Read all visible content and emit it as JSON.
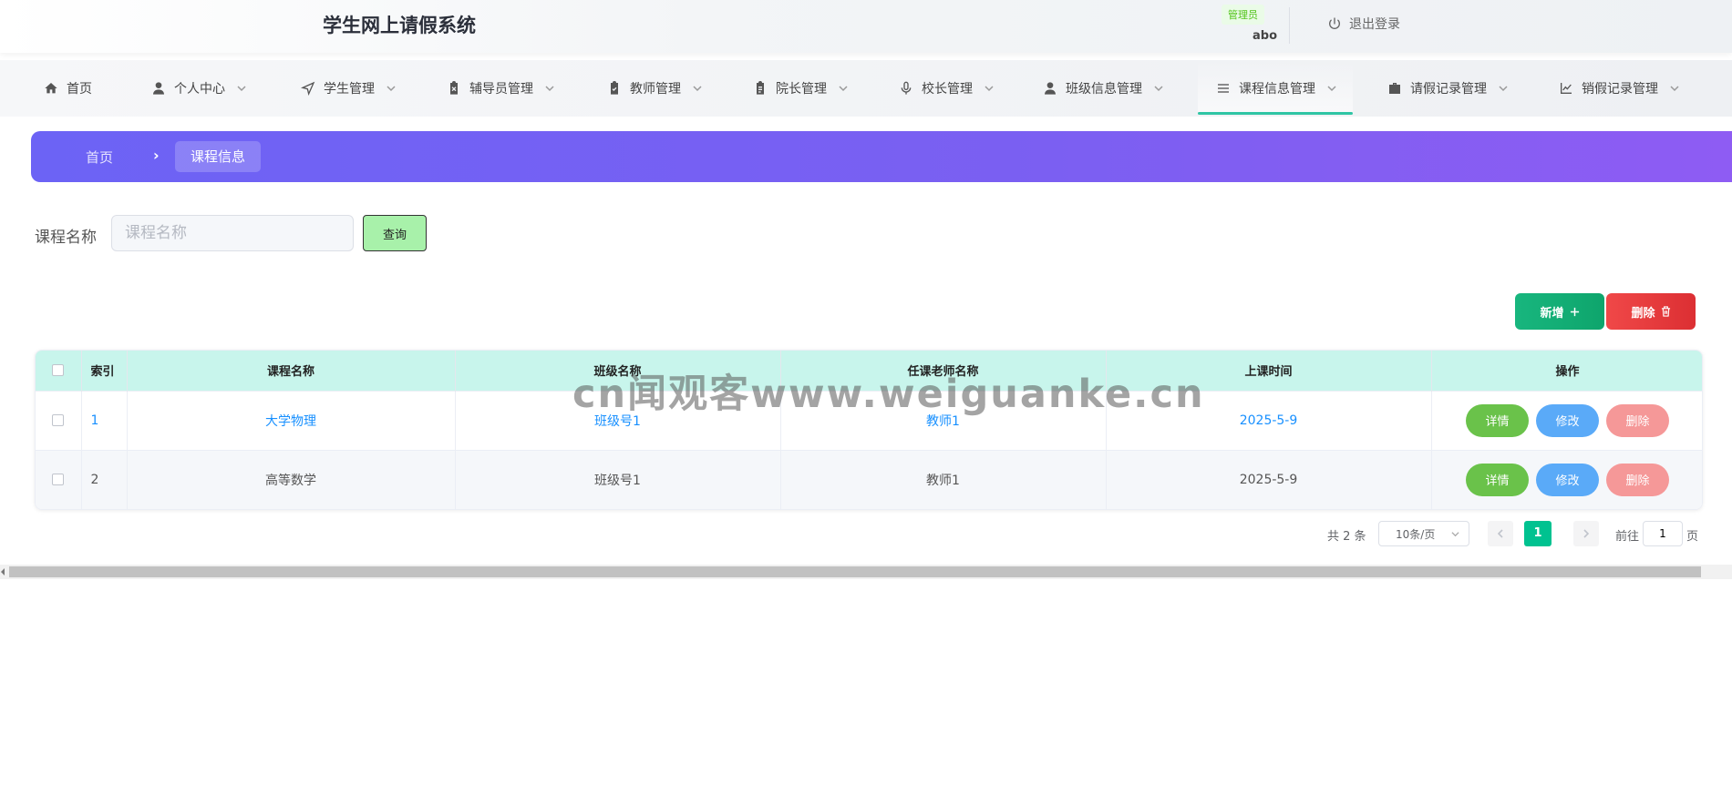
{
  "header": {
    "app_title": "学生网上请假系统",
    "role": "管理员",
    "username": "abo",
    "logout_label": "退出登录"
  },
  "nav": {
    "items": [
      {
        "label": "首页",
        "icon": "home-icon",
        "dropdown": false
      },
      {
        "label": "个人中心",
        "icon": "user-icon",
        "dropdown": true
      },
      {
        "label": "学生管理",
        "icon": "send-icon",
        "dropdown": true
      },
      {
        "label": "辅导员管理",
        "icon": "clipboard-x-icon",
        "dropdown": true
      },
      {
        "label": "教师管理",
        "icon": "clipboard-check-icon",
        "dropdown": true
      },
      {
        "label": "院长管理",
        "icon": "clipboard-icon",
        "dropdown": true
      },
      {
        "label": "校长管理",
        "icon": "microphone-icon",
        "dropdown": true
      },
      {
        "label": "班级信息管理",
        "icon": "user-icon",
        "dropdown": true
      },
      {
        "label": "课程信息管理",
        "icon": "list-icon",
        "dropdown": true,
        "active": true
      },
      {
        "label": "请假记录管理",
        "icon": "briefcase-icon",
        "dropdown": true
      },
      {
        "label": "销假记录管理",
        "icon": "chart-line-icon",
        "dropdown": true
      }
    ]
  },
  "breadcrumb": {
    "home": "首页",
    "separator": "›",
    "current": "课程信息"
  },
  "search": {
    "label": "课程名称",
    "placeholder": "课程名称",
    "value": "",
    "button_label": "查询"
  },
  "actions": {
    "add_label": "新增",
    "delete_label": "删除"
  },
  "table": {
    "columns": [
      "索引",
      "课程名称",
      "班级名称",
      "任课老师名称",
      "上课时间",
      "操作"
    ],
    "rows": [
      {
        "index": "1",
        "course": "大学物理",
        "class": "班级号1",
        "teacher": "教师1",
        "time": "2025-5-9"
      },
      {
        "index": "2",
        "course": "高等数学",
        "class": "班级号1",
        "teacher": "教师1",
        "time": "2025-5-9"
      }
    ],
    "row_actions": {
      "detail": "详情",
      "edit": "修改",
      "delete": "删除"
    }
  },
  "pagination": {
    "total": "共 2 条",
    "page_size": "10条/页",
    "current_page": "1",
    "goto_label": "前往",
    "goto_value": "1",
    "page_suffix": "页"
  },
  "watermark": "cn闻观客www.weiguanke.cn",
  "colors": {
    "accent": "#00c290",
    "breadcrumb_gradient_start": "#6c63f5",
    "breadcrumb_gradient_end": "#8e5cf3",
    "table_header": "#c8f5ec",
    "add_button": "#18b67e",
    "delete_button": "#e8383d",
    "detail_button": "#6ac24a",
    "edit_button": "#5aaaf8",
    "row_delete_button": "#f59898",
    "link_text": "#1890ff"
  }
}
